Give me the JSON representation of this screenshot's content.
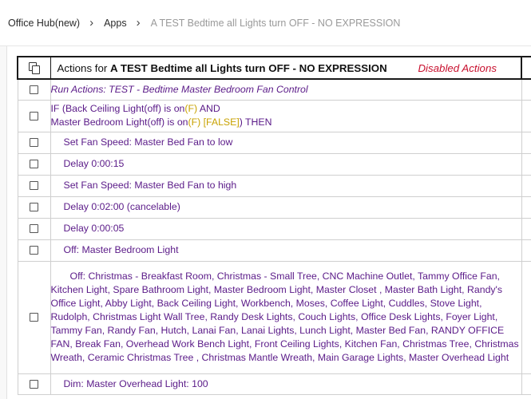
{
  "breadcrumb": {
    "hub": "Office Hub(new)",
    "apps": "Apps",
    "current": "A TEST Bedtime all Lights turn OFF - NO EXPRESSION"
  },
  "table": {
    "header": {
      "prefix": "Actions for ",
      "title": "A TEST Bedtime  all Lights turn OFF   - NO EXPRESSION",
      "disabled_actions": "Disabled Actions"
    },
    "run_actions": "Run Actions: TEST - Bedtime  Master Bedroom Fan Control",
    "if_line1_a": "IF (Back Ceiling Light(off) is on",
    "if_line1_f": "(F)",
    "if_line1_and": "  AND",
    "if_line2_a": "Master Bedroom Light(off) is on",
    "if_line2_f": "(F) [FALSE]",
    "if_line2_then": ") THEN",
    "rows": [
      "Set Fan Speed: Master Bed Fan to low",
      "Delay 0:00:15",
      "Set Fan Speed: Master Bed Fan to high",
      "Delay 0:02:00 (cancelable)",
      "Delay 0:00:05",
      "Off: Master Bedroom Light"
    ],
    "off_long": "Off: Christmas - Breakfast Room, Christmas - Small Tree, CNC Machine Outlet, Tammy Office Fan, Kitchen Light, Spare Bathroom Light, Master Bedroom Light, Master Closet , Master Bath Light, Randy's Office Light, Abby Light, Back Ceiling Light, Workbench, Moses, Coffee Light, Cuddles, Stove Light, Rudolph, Christmas Light Wall Tree, Randy Desk Lights, Couch Lights, Office Desk Lights, Foyer Light, Tammy Fan, Randy Fan, Hutch, Lanai Fan, Lanai Lights, Lunch Light, Master Bed Fan, RANDY OFFICE FAN, Break Fan, Overhead Work Bench Light, Front Ceiling Lights, Kitchen Fan, Christmas Tree, Christmas Wreath, Ceramic Christmas Tree , Christmas Mantle Wreath, Main Garage Lights, Master Overhead Light",
    "dim": "Dim: Master Overhead Light: 100"
  }
}
